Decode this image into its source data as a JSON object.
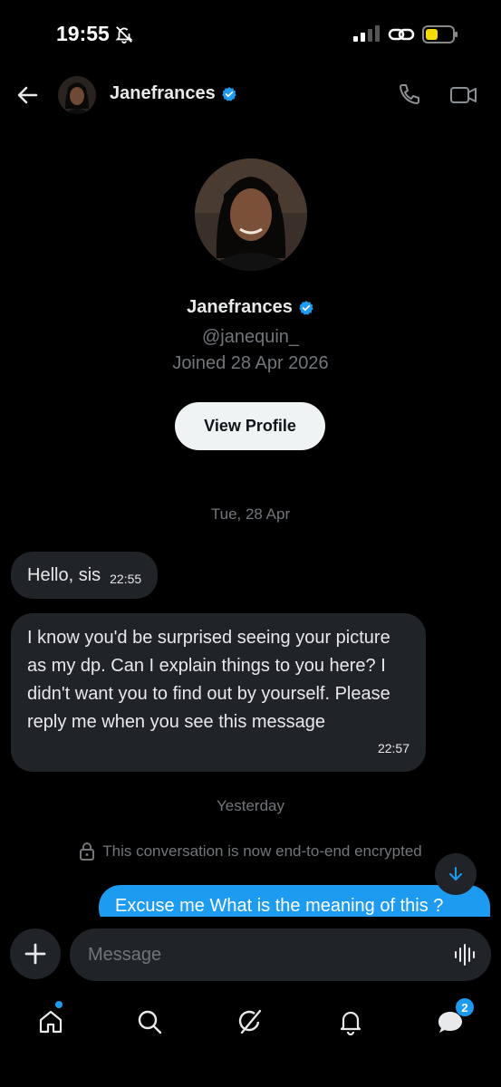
{
  "status_bar": {
    "time": "19:55",
    "icons": [
      "bell-off-icon",
      "signal-icon",
      "link-icon",
      "battery-icon"
    ]
  },
  "header": {
    "name": "Janefrances",
    "verified": true,
    "icons": [
      "back-arrow-icon",
      "phone-icon",
      "video-icon"
    ]
  },
  "profile": {
    "name": "Janefrances",
    "handle": "@janequin_",
    "joined": "Joined 28 Apr 2026",
    "view_profile_label": "View Profile"
  },
  "conversation": {
    "date_1": "Tue, 28 Apr",
    "messages_in": [
      {
        "text": "Hello, sis",
        "time": "22:55"
      },
      {
        "text": "I know you'd be surprised seeing your picture as my dp. Can I explain things to you here? I didn't want you to find out by yourself. Please reply me when you see this message",
        "time": "22:57"
      }
    ],
    "date_2": "Yesterday",
    "encryption_notice": "This conversation is now end-to-end encrypted",
    "message_out": {
      "text": "Excuse me What is the meaning of this ?"
    }
  },
  "composer": {
    "placeholder": "Message"
  },
  "bottom_nav": {
    "items": [
      "home-icon",
      "search-icon",
      "grok-icon",
      "notifications-icon",
      "messages-icon"
    ],
    "messages_badge": "2"
  },
  "colors": {
    "background": "#000000",
    "bubble_incoming": "#202327",
    "bubble_outgoing": "#1d9bf0",
    "muted_text": "#71767b",
    "verified_badge": "#1d9bf0"
  }
}
